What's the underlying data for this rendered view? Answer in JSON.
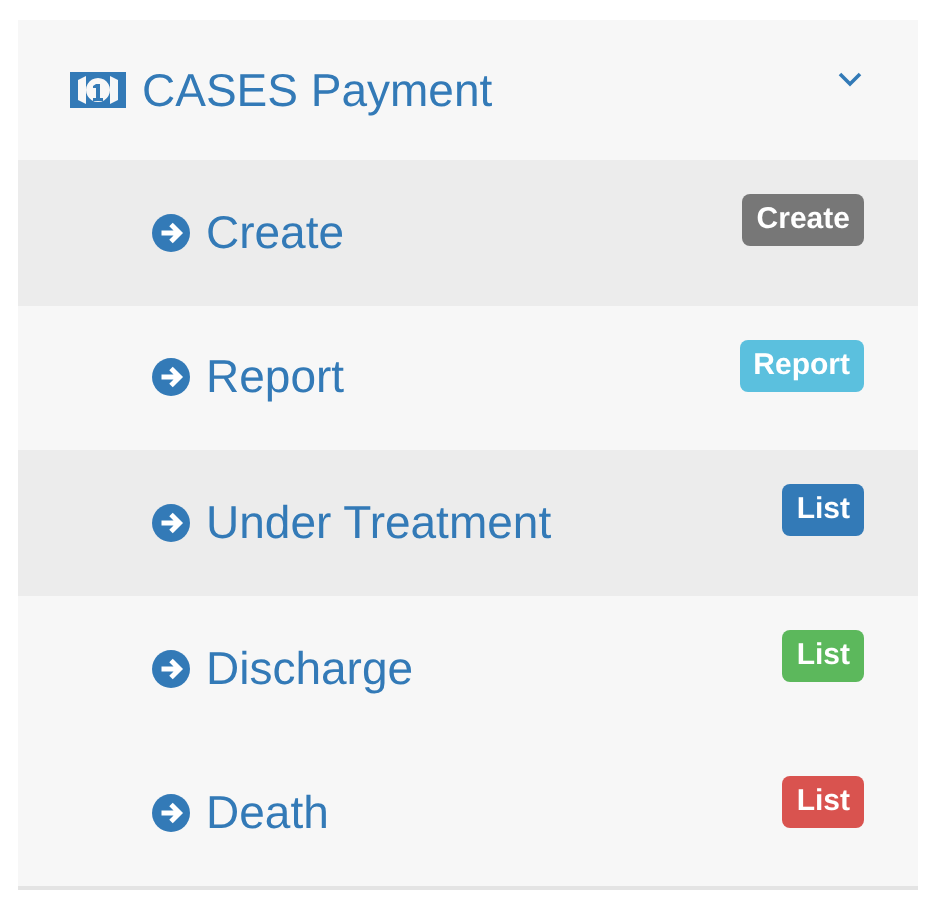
{
  "menu": {
    "title": "CASES Payment",
    "expanded": true,
    "items": [
      {
        "label": "Create",
        "highlighted": true,
        "badge": "Create",
        "color": "#777777"
      },
      {
        "label": "Report",
        "highlighted": false,
        "badge": "Report",
        "color": "#5bc0de"
      },
      {
        "label": "Under Treatment",
        "highlighted": true,
        "badge": "List",
        "color": "#337ab7"
      },
      {
        "label": "Discharge",
        "highlighted": false,
        "badge": "List",
        "color": "#5cb85c"
      },
      {
        "label": "Death",
        "highlighted": false,
        "badge": "List",
        "color": "#d9534f"
      }
    ]
  }
}
